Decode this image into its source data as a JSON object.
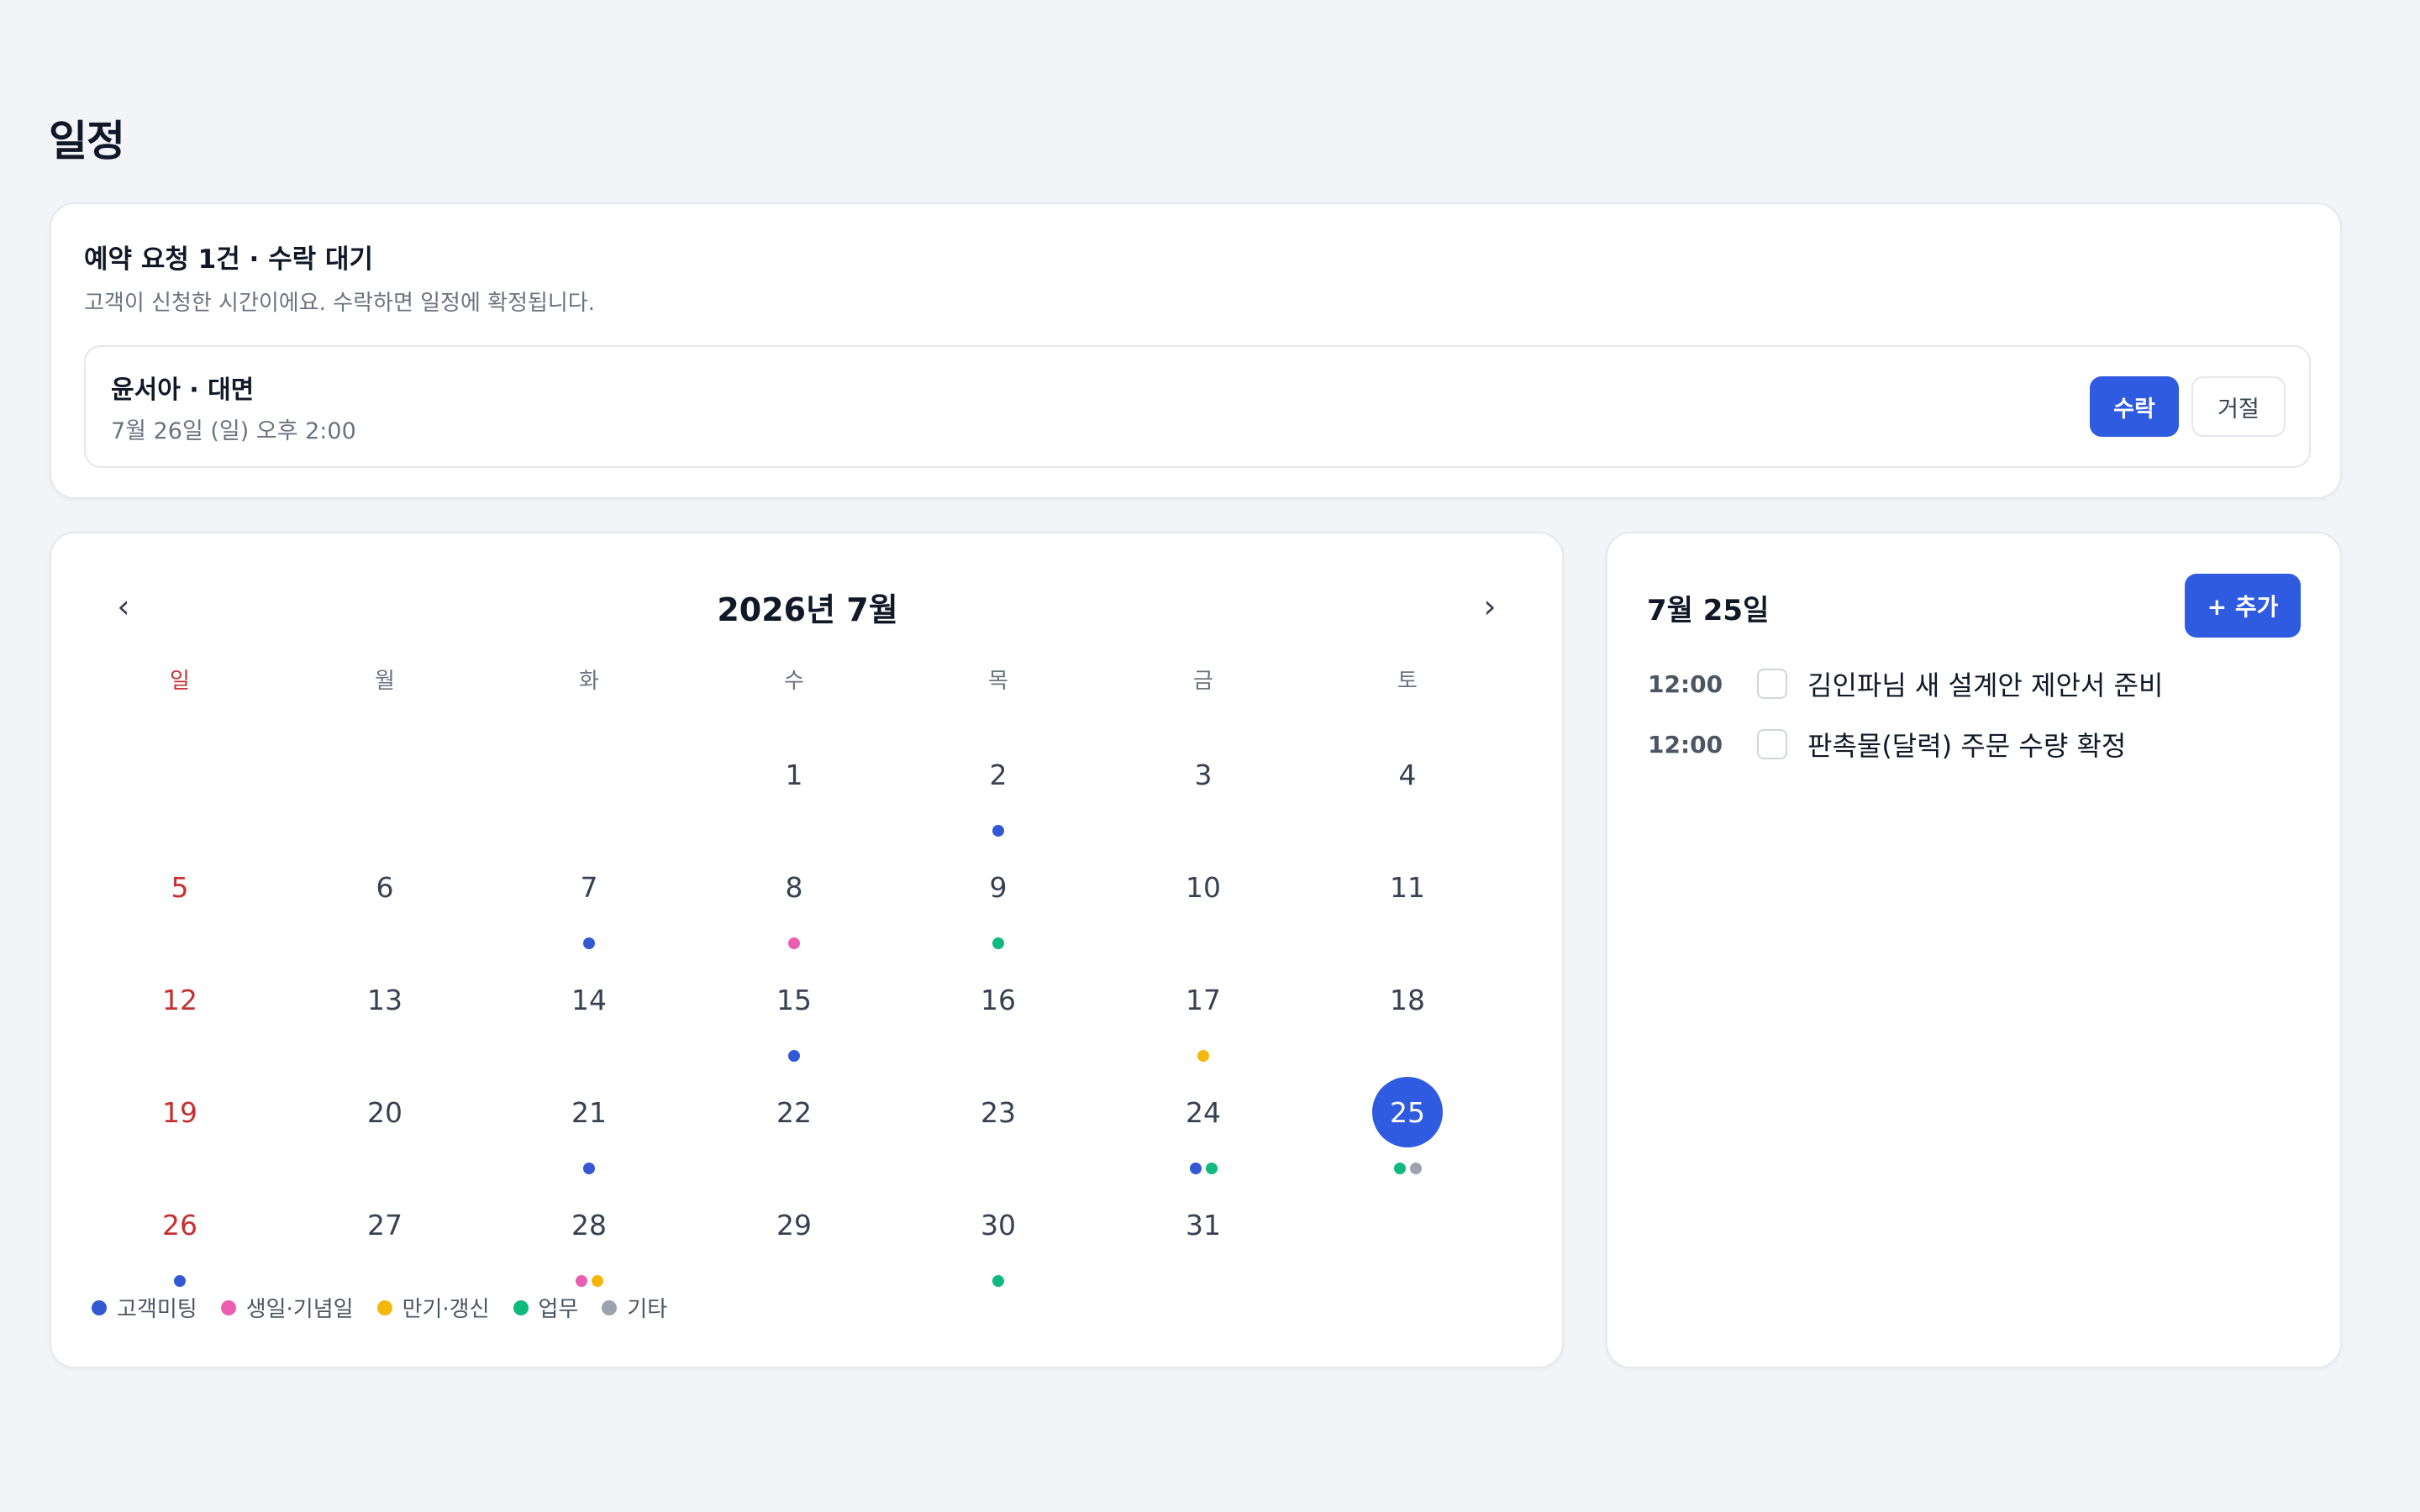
{
  "page": {
    "title": "일정"
  },
  "request": {
    "title": "예약 요청 1건 · 수락 대기",
    "subtitle": "고객이 신청한 시간이에요. 수락하면 일정에 확정됩니다.",
    "item": {
      "name": "윤서아 · 대면",
      "time": "7월 26일 (일) 오후 2:00",
      "accept_label": "수락",
      "reject_label": "거절"
    }
  },
  "calendar": {
    "month_label": "2026년 7월",
    "prev_icon": "‹",
    "next_icon": "›",
    "weekdays": [
      "일",
      "월",
      "화",
      "수",
      "목",
      "금",
      "토"
    ],
    "first_weekday_index": 3,
    "days_in_month": 31,
    "selected_day": 25,
    "events": {
      "2": [
        "meeting"
      ],
      "7": [
        "meeting"
      ],
      "8": [
        "birthday"
      ],
      "9": [
        "work"
      ],
      "15": [
        "meeting"
      ],
      "17": [
        "renewal"
      ],
      "21": [
        "meeting"
      ],
      "24": [
        "meeting",
        "work"
      ],
      "25": [
        "work",
        "other"
      ],
      "26": [
        "meeting"
      ],
      "28": [
        "birthday",
        "renewal"
      ],
      "30": [
        "work"
      ]
    },
    "legend": [
      {
        "key": "meeting",
        "label": "고객미팅",
        "color": "#3358d4"
      },
      {
        "key": "birthday",
        "label": "생일·기념일",
        "color": "#ec5fb0"
      },
      {
        "key": "renewal",
        "label": "만기·갱신",
        "color": "#f6b70c"
      },
      {
        "key": "work",
        "label": "업무",
        "color": "#10b97d"
      },
      {
        "key": "other",
        "label": "기타",
        "color": "#9ca3af"
      }
    ]
  },
  "day_panel": {
    "title": "7월 25일",
    "add_label": "+ 추가",
    "tasks": [
      {
        "time": "12:00",
        "title": "김인파님 새 설계안 제안서 준비",
        "done": false
      },
      {
        "time": "12:00",
        "title": "판촉물(달력) 주문 수량 확정",
        "done": false
      }
    ]
  }
}
